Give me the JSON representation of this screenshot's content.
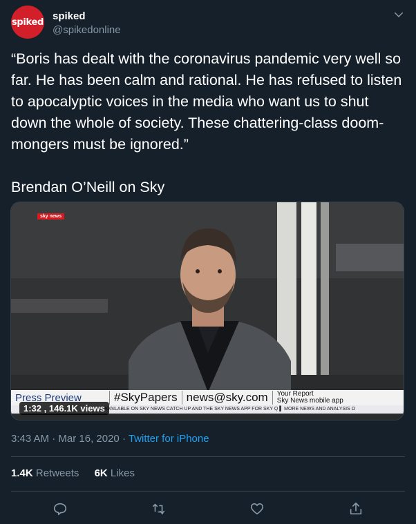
{
  "account": {
    "avatar_text": "spiked",
    "display_name": "spiked",
    "handle": "@spikedonline"
  },
  "tweet": {
    "text": "“Boris has dealt with the coronavirus pandemic very well so far. He has been calm and rational. He has refused to listen to apocalyptic voices in the media who want us to shut down the whole of society. These chattering-class doom-mongers must be ignored.”\n\nBrendan O’Neill on Sky"
  },
  "video": {
    "channel_logo": "sky news",
    "ticker": {
      "segment1": "Press Preview",
      "segment2": "#SkyPapers",
      "segment3": "news@sky.com",
      "segment4_line1": "Your Report",
      "segment4_line2": "Sky News mobile app"
    },
    "crawl_text": "AVAILABLE ON SKY NEWS CATCH UP AND THE SKY NEWS APP FOR SKY Q  ▌  MORE NEWS AND ANALYSIS O",
    "duration": "1:32",
    "views": "146.1K views"
  },
  "meta": {
    "time": "3:43 AM",
    "separator1": " · ",
    "date": "Mar 16, 2020",
    "separator2": " · ",
    "source": "Twitter for iPhone"
  },
  "stats": {
    "retweets_count": "1.4K",
    "retweets_label": "Retweets",
    "likes_count": "6K",
    "likes_label": "Likes"
  },
  "icons": {
    "reply": "reply-icon",
    "retweet": "retweet-icon",
    "like": "heart-icon",
    "share": "share-icon",
    "caret": "chevron-down-icon"
  },
  "colors": {
    "background": "#15202b",
    "secondary_text": "#8899a6",
    "link": "#1da1f2",
    "border": "#38444d",
    "avatar": "#d21f2a"
  }
}
